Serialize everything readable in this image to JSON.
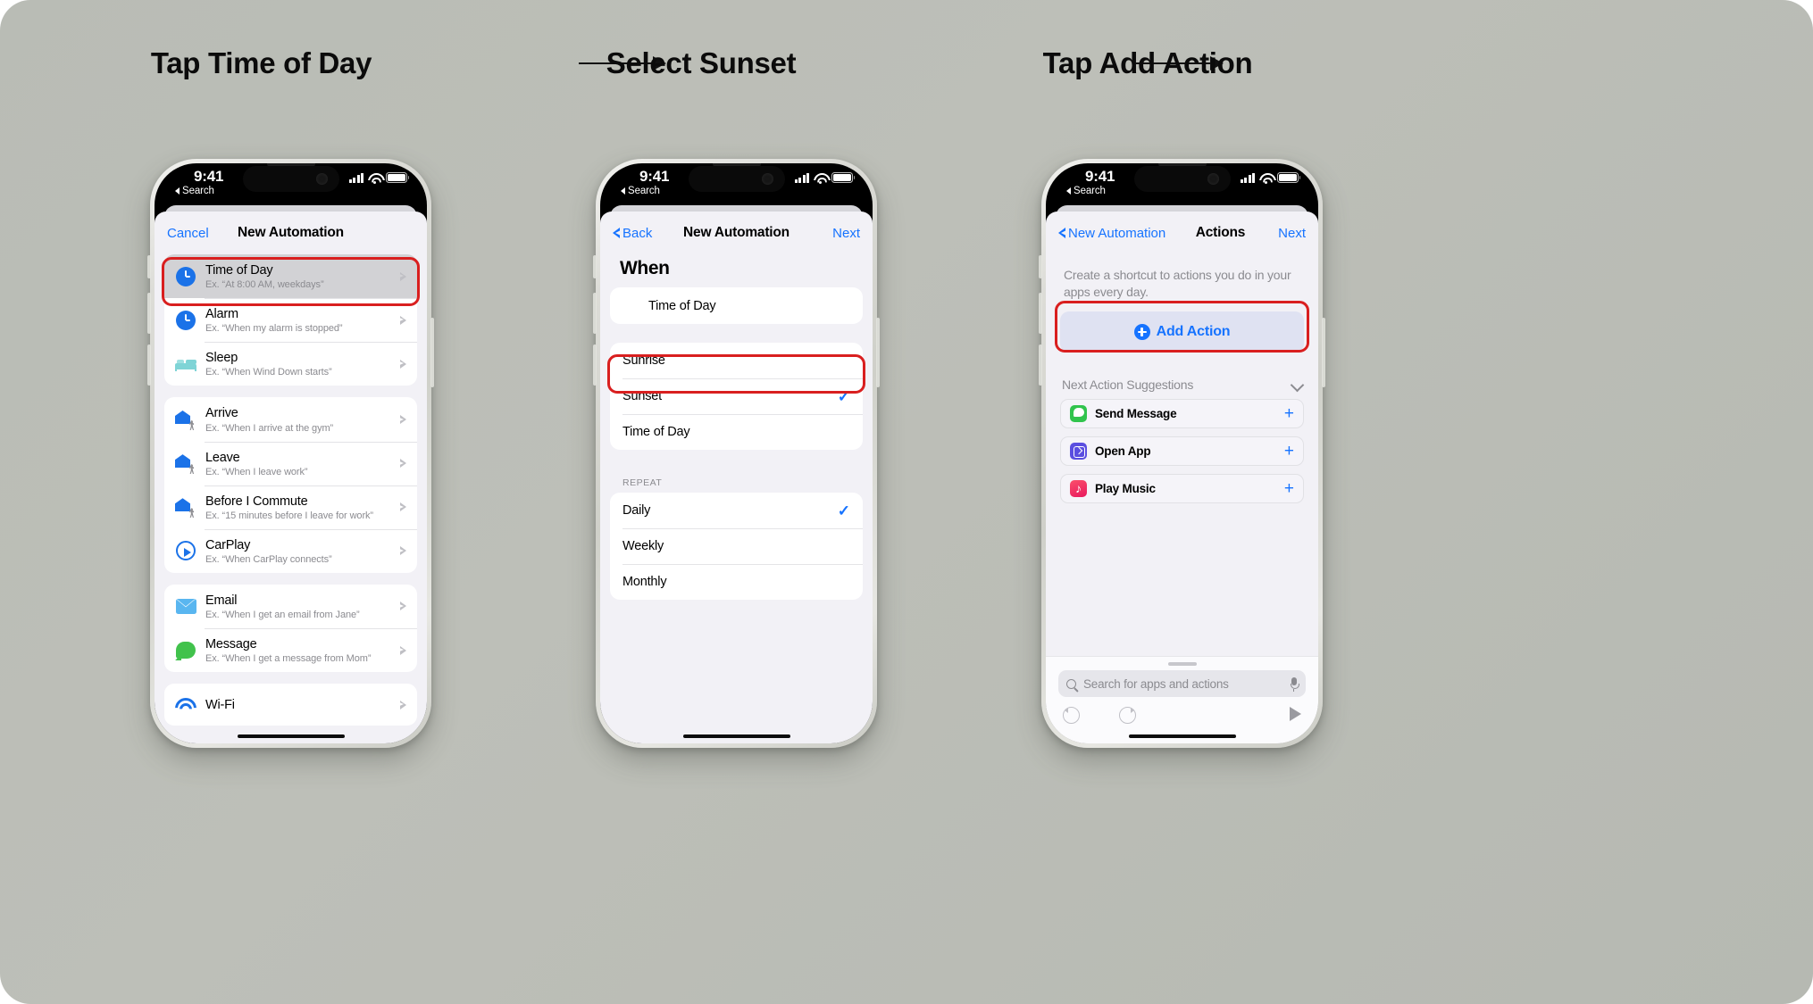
{
  "steps": [
    {
      "caption": "Tap Time of Day"
    },
    {
      "caption": "Select Sunset"
    },
    {
      "caption": "Tap Add Action"
    }
  ],
  "statusbar": {
    "time": "9:41",
    "back_label": "Search"
  },
  "phone1": {
    "nav": {
      "left_label": "Cancel",
      "title": "New Automation"
    },
    "groups": [
      {
        "rows": [
          {
            "icon": "clock-icon",
            "title": "Time of Day",
            "example": "Ex. “At 8:00 AM, weekdays”",
            "selected": true
          },
          {
            "icon": "clock-icon",
            "title": "Alarm",
            "example": "Ex. “When my alarm is stopped”",
            "selected": false
          },
          {
            "icon": "bed-icon",
            "title": "Sleep",
            "example": "Ex. “When Wind Down starts”",
            "selected": false
          }
        ]
      },
      {
        "rows": [
          {
            "icon": "home-arrive-icon",
            "title": "Arrive",
            "example": "Ex. “When I arrive at the gym”",
            "selected": false
          },
          {
            "icon": "home-leave-icon",
            "title": "Leave",
            "example": "Ex. “When I leave work”",
            "selected": false
          },
          {
            "icon": "home-commute-icon",
            "title": "Before I Commute",
            "example": "Ex. “15 minutes before I leave for work”",
            "selected": false
          },
          {
            "icon": "carplay-icon",
            "title": "CarPlay",
            "example": "Ex. “When CarPlay connects”",
            "selected": false
          }
        ]
      },
      {
        "rows": [
          {
            "icon": "mail-icon",
            "title": "Email",
            "example": "Ex. “When I get an email from Jane”",
            "selected": false
          },
          {
            "icon": "message-icon",
            "title": "Message",
            "example": "Ex. “When I get a message from Mom”",
            "selected": false
          }
        ]
      },
      {
        "rows": [
          {
            "icon": "wifi-icon",
            "title": "Wi-Fi",
            "example": "",
            "selected": false
          }
        ]
      }
    ]
  },
  "phone2": {
    "nav": {
      "left_label": "Back",
      "title": "New Automation",
      "right_label": "Next"
    },
    "section_title": "When",
    "when_row": {
      "icon": "clock-icon",
      "label": "Time of Day"
    },
    "trigger_options": [
      {
        "label": "Sunrise",
        "checked": false,
        "highlighted": false
      },
      {
        "label": "Sunset",
        "checked": true,
        "highlighted": true
      },
      {
        "label": "Time of Day",
        "checked": false,
        "highlighted": false
      }
    ],
    "repeat_label": "REPEAT",
    "repeat_options": [
      {
        "label": "Daily",
        "checked": true
      },
      {
        "label": "Weekly",
        "checked": false
      },
      {
        "label": "Monthly",
        "checked": false
      }
    ],
    "checkmark": "✓"
  },
  "phone3": {
    "nav": {
      "left_label": "New Automation",
      "title": "Actions",
      "right_label": "Next"
    },
    "description": "Create a shortcut to actions you do in your apps every day.",
    "add_action_label": "Add Action",
    "suggestions_header": "Next Action Suggestions",
    "suggestions": [
      {
        "icon": "messages-app-icon",
        "label": "Send Message",
        "add": "+"
      },
      {
        "icon": "open-app-icon",
        "label": "Open App",
        "add": "+"
      },
      {
        "icon": "music-app-icon",
        "label": "Play Music",
        "add": "+"
      }
    ],
    "search_placeholder": "Search for apps and actions"
  },
  "colors": {
    "accent_blue": "#1673ff",
    "highlight_red": "#d91f1f",
    "background": "#b9bcb5"
  }
}
